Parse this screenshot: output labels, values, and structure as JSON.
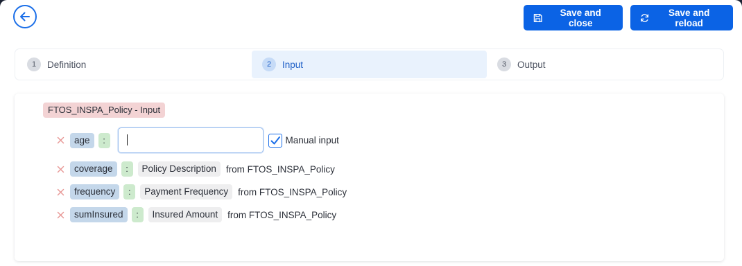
{
  "header": {
    "back_icon": "arrow-left-circle-icon",
    "save_close_label": "Save and close",
    "save_reload_label": "Save and reload"
  },
  "steps": [
    {
      "num": "1",
      "label": "Definition",
      "active": false
    },
    {
      "num": "2",
      "label": "Input",
      "active": true
    },
    {
      "num": "3",
      "label": "Output",
      "active": false
    }
  ],
  "card": {
    "entity_tag": "FTOS_INSPA_Policy - Input",
    "rows": [
      {
        "name": "age",
        "colon": ":",
        "input_value": "",
        "manual_label": "Manual input",
        "manual_checked": true
      },
      {
        "name": "coverage",
        "colon": ":",
        "description": "Policy Description",
        "from": "from FTOS_INSPA_Policy"
      },
      {
        "name": "frequency",
        "colon": ":",
        "description": "Payment Frequency",
        "from": "from FTOS_INSPA_Policy"
      },
      {
        "name": "sumInsured",
        "colon": ":",
        "description": "Insured Amount",
        "from": "from FTOS_INSPA_Policy"
      }
    ]
  },
  "colors": {
    "accent": "#0b63e5",
    "active_step_bg": "#e9f2fd",
    "entity_tag_bg": "#f3d3d4",
    "var_pill_bg": "#c4d7ea",
    "colon_pill_bg": "#cdeacd",
    "desc_pill_bg": "#eeeeef",
    "remove_icon": "#e89a98"
  }
}
